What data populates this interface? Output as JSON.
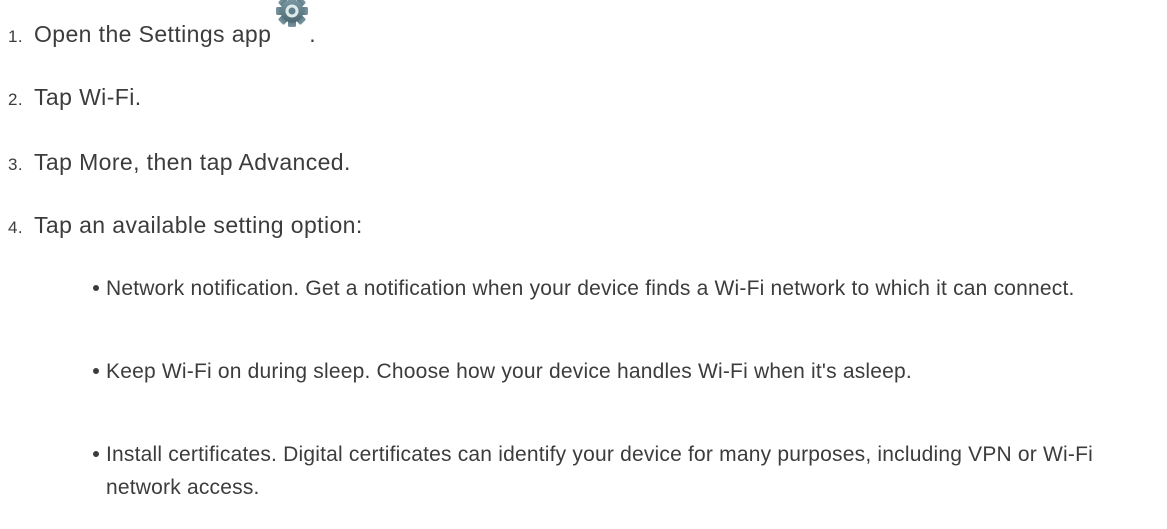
{
  "steps": [
    {
      "number": "1.",
      "text": "Open the Settings app",
      "suffix": "."
    },
    {
      "number": "2.",
      "text": "Tap Wi-Fi."
    },
    {
      "number": "3.",
      "text": "Tap More, then tap Advanced."
    },
    {
      "number": "4.",
      "text": "Tap an available setting option:"
    }
  ],
  "settings_icon": {
    "name": "gear-icon",
    "color": "#5f7f8c"
  },
  "options": [
    {
      "text": "Network notification. Get a notification when your device finds a Wi-Fi network to which it can connect."
    },
    {
      "text": "Keep Wi-Fi on during sleep. Choose how your device handles Wi-Fi when it's asleep."
    },
    {
      "text": "Install certificates. Digital certificates can identify your device for many purposes, including VPN or Wi-Fi network access."
    }
  ]
}
